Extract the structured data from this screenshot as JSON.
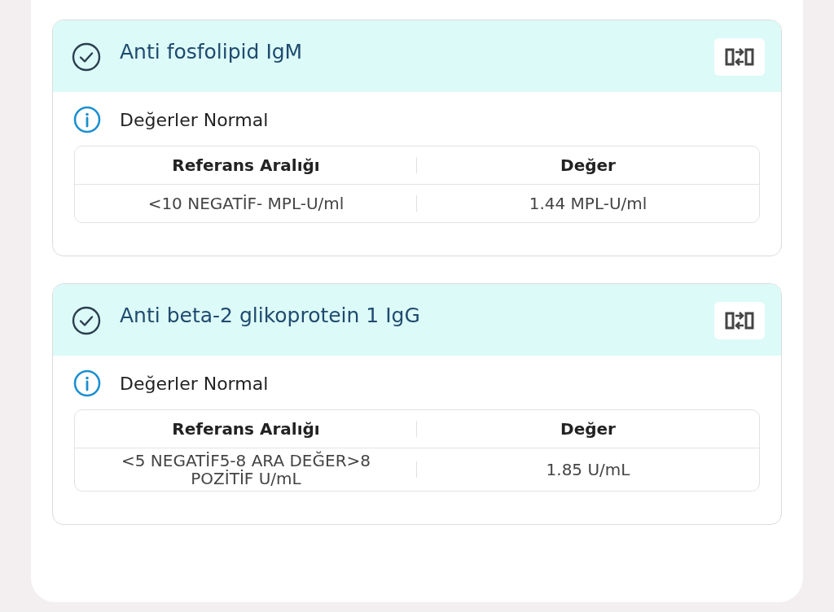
{
  "cards": [
    {
      "title": "Anti fosfolipid IgM",
      "status": "Değerler Normal",
      "columns": [
        "Referans Aralığı",
        "Değer"
      ],
      "rows": [
        {
          "range": "<10 NEGATİF- MPL-U/ml",
          "value": "1.44 MPL-U/ml"
        }
      ]
    },
    {
      "title": "Anti beta-2 glikoprotein 1 IgG",
      "status": "Değerler Normal",
      "columns": [
        "Referans Aralığı",
        "Değer"
      ],
      "rows": [
        {
          "range": "<5 NEGATİF5-8 ARA DEĞER>8 POZİTİF U/mL",
          "value": "1.85 U/mL"
        }
      ]
    }
  ]
}
